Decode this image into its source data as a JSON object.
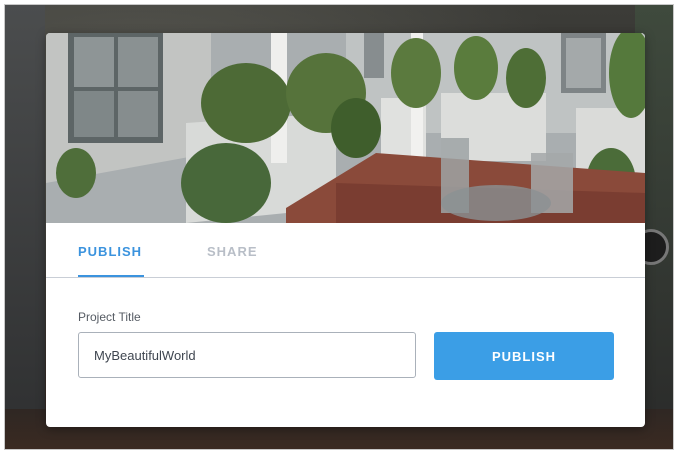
{
  "tabs": [
    {
      "label": "PUBLISH",
      "active": true
    },
    {
      "label": "SHARE",
      "active": false
    }
  ],
  "form": {
    "label": "Project Title",
    "value": "MyBeautifulWorld"
  },
  "actions": {
    "publish_label": "PUBLISH"
  },
  "colors": {
    "accent": "#3b93de",
    "button": "#3b9ee6",
    "inactive_tab": "#b8bec7"
  }
}
